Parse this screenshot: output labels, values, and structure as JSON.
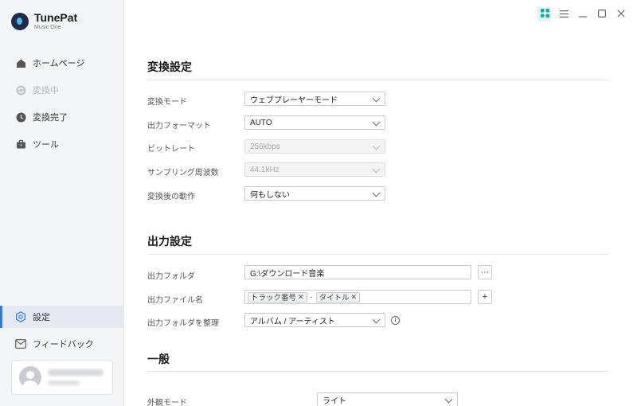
{
  "app": {
    "name": "TunePat",
    "subtitle": "Music One"
  },
  "nav": {
    "home": "ホームページ",
    "converting": "変換中",
    "converted": "変換完了",
    "tools": "ツール",
    "settings": "設定",
    "feedback": "フィードバック"
  },
  "conversion": {
    "title": "変換設定",
    "mode_label": "変換モード",
    "mode_value": "ウェブプレーヤーモード",
    "format_label": "出力フォーマット",
    "format_value": "AUTO",
    "bitrate_label": "ビットレート",
    "bitrate_value": "256kbps",
    "samplerate_label": "サンプリング周波数",
    "samplerate_value": "44.1kHz",
    "after_label": "変換後の動作",
    "after_value": "何もしない"
  },
  "output": {
    "title": "出力設定",
    "folder_label": "出力フォルダ",
    "folder_value": "G:\\ダウンロード音楽",
    "folder_browse": "···",
    "filename_label": "出力ファイル名",
    "filename_tags": [
      "トラック番号",
      "タイトル"
    ],
    "filename_separator": "-",
    "filename_add": "+",
    "organize_label": "出力フォルダを整理",
    "organize_value": "アルバム / アーティスト",
    "info": "i"
  },
  "general": {
    "title": "一般",
    "appearance_label": "外観モード",
    "appearance_value": "ライト"
  },
  "icons": {
    "home": "home-icon",
    "converting": "sync-icon",
    "converted": "clock-icon",
    "tools": "toolbox-icon",
    "settings": "gear-icon",
    "feedback": "mail-icon"
  },
  "colors": {
    "accent": "#2a7de1",
    "teal": "#1fa8a0"
  }
}
